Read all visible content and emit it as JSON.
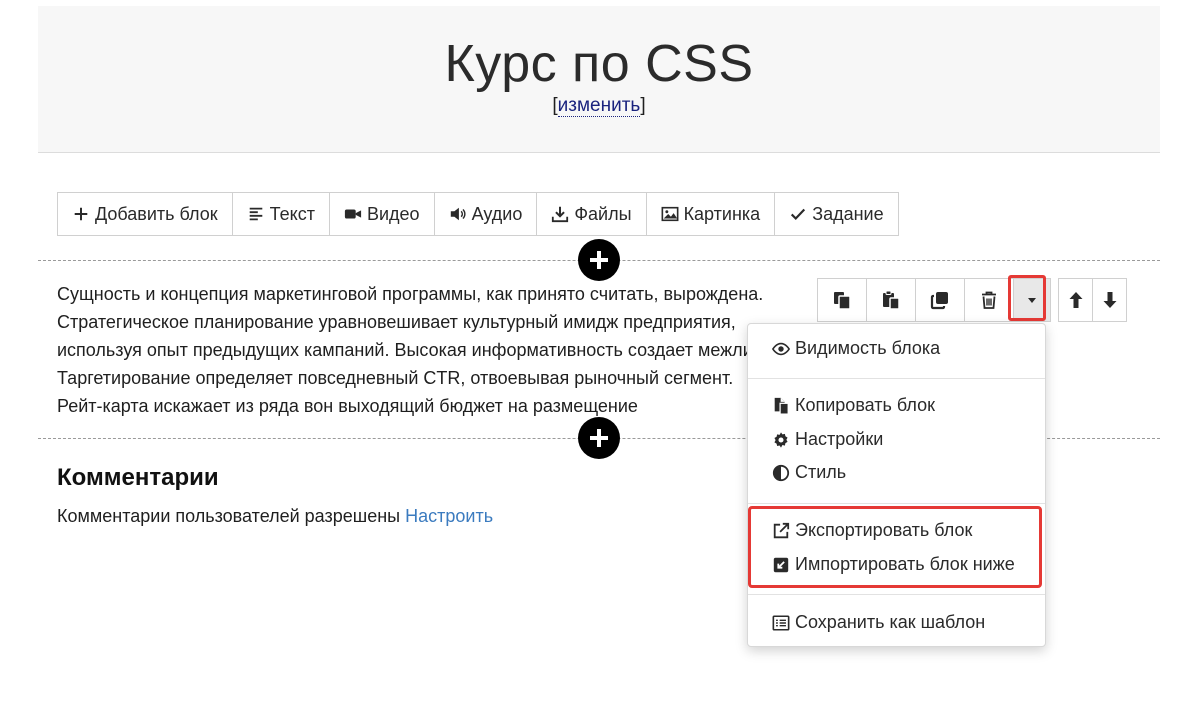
{
  "header": {
    "title": "Курс по CSS",
    "edit_open": "[",
    "edit_label": "изменить",
    "edit_close": "]"
  },
  "toolbar": {
    "items": [
      {
        "label": "Добавить блок",
        "icon": "plus-icon"
      },
      {
        "label": "Текст",
        "icon": "align-left-icon"
      },
      {
        "label": "Видео",
        "icon": "video-camera-icon"
      },
      {
        "label": "Аудио",
        "icon": "volume-icon"
      },
      {
        "label": "Файлы",
        "icon": "download-icon"
      },
      {
        "label": "Картинка",
        "icon": "image-icon"
      },
      {
        "label": "Задание",
        "icon": "check-icon"
      }
    ]
  },
  "content": {
    "lines": [
      "Сущность и концепция маркетинговой программы, как принято считать, вырождена.",
      "Стратегическое планирование уравновешивает культурный имидж предприятия,",
      "используя опыт предыдущих кампаний. Высокая информативность создает межличностный",
      "Таргетирование определяет повседневный CTR, отвоевывая рыночный сегмент.",
      "Рейт-карта искажает из ряда вон выходящий бюджет на размещение"
    ]
  },
  "block_controls": {
    "icons": [
      "copy-icon",
      "paste-icon",
      "clone-icon",
      "trash-icon",
      "caret-down-icon"
    ],
    "move_icons": [
      "arrow-up-icon",
      "arrow-down-icon"
    ]
  },
  "dropdown": {
    "items": [
      {
        "label": "Видимость блока",
        "icon": "eye-icon"
      },
      {
        "label": "Копировать блок",
        "icon": "copy-file-icon"
      },
      {
        "label": "Настройки",
        "icon": "gear-icon"
      },
      {
        "label": "Стиль",
        "icon": "contrast-icon"
      },
      {
        "label": "Экспортировать блок",
        "icon": "external-link-icon"
      },
      {
        "label": "Импортировать блок ниже",
        "icon": "import-icon"
      },
      {
        "label": "Сохранить как шаблон",
        "icon": "list-icon"
      }
    ]
  },
  "comments": {
    "heading": "Комментарии",
    "text": "Комментарии пользователей разрешены",
    "link": "Настроить"
  },
  "colors": {
    "highlight": "#e53935",
    "link": "#3b7bbf",
    "edit_link": "#1a237e"
  }
}
